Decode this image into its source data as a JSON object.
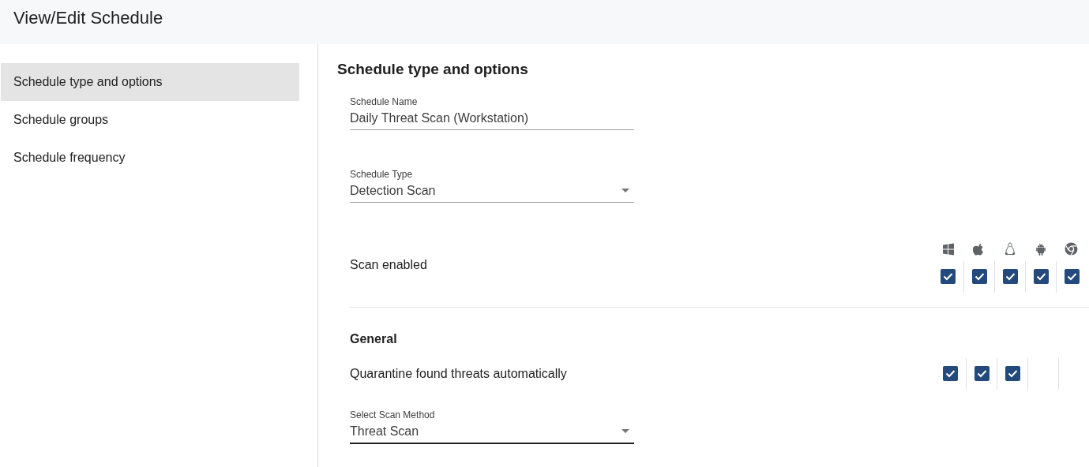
{
  "header": {
    "title": "View/Edit Schedule"
  },
  "sidebar": {
    "items": [
      {
        "label": "Schedule type and options",
        "selected": true
      },
      {
        "label": "Schedule groups",
        "selected": false
      },
      {
        "label": "Schedule frequency",
        "selected": false
      }
    ]
  },
  "section_title": "Schedule type and options",
  "fields": [
    {
      "kind": "text",
      "label": "Schedule Name",
      "value": "Daily Threat Scan (Workstation)",
      "focused": false
    },
    {
      "kind": "select",
      "label": "Schedule Type",
      "value": "Detection Scan",
      "focused": false
    }
  ],
  "platforms": [
    {
      "kind": "windows"
    },
    {
      "kind": "apple"
    },
    {
      "kind": "linux"
    },
    {
      "kind": "android"
    },
    {
      "kind": "chrome"
    }
  ],
  "scan_enabled": {
    "label": "Scan enabled",
    "checks": [
      {
        "checked": true
      },
      {
        "checked": true
      },
      {
        "checked": true
      },
      {
        "checked": true
      },
      {
        "checked": true
      }
    ]
  },
  "general": {
    "heading": "General",
    "quarantine": {
      "label": "Quarantine found threats automatically",
      "checks": [
        {
          "checked": true
        },
        {
          "checked": true
        },
        {
          "checked": true
        }
      ]
    },
    "scan_method": {
      "kind": "select",
      "label": "Select Scan Method",
      "value": "Threat Scan",
      "focused": true
    }
  }
}
